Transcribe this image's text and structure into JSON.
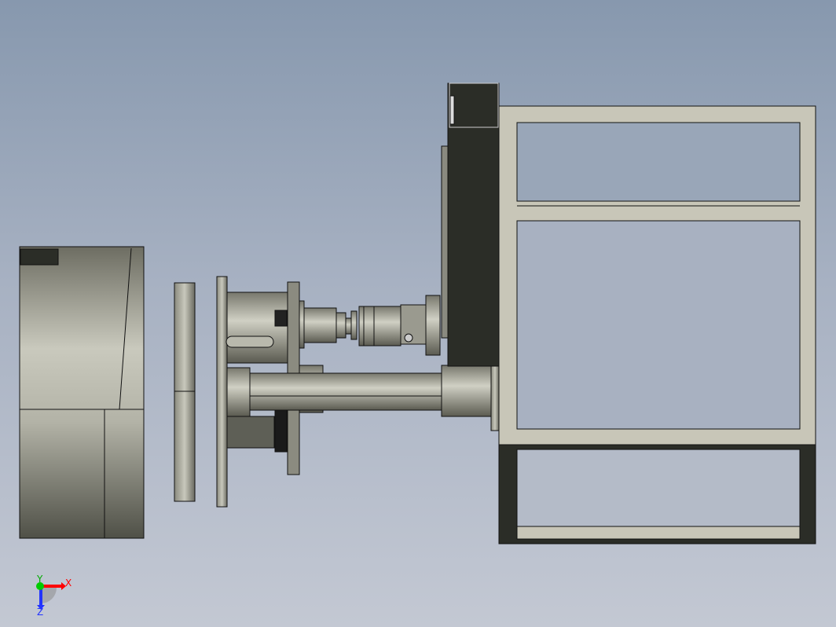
{
  "viewport": {
    "background_top": "#8798ae",
    "background_bottom": "#c3c8d3",
    "part_light": "#c9c9bd",
    "part_dark": "#2b2d27",
    "frame_color": "#c8c6b8"
  },
  "triad": {
    "x_label": "X",
    "y_label": "Y",
    "z_label": "Z",
    "x_color": "#ff0000",
    "y_color": "#00cc00",
    "z_color": "#2233ff"
  }
}
